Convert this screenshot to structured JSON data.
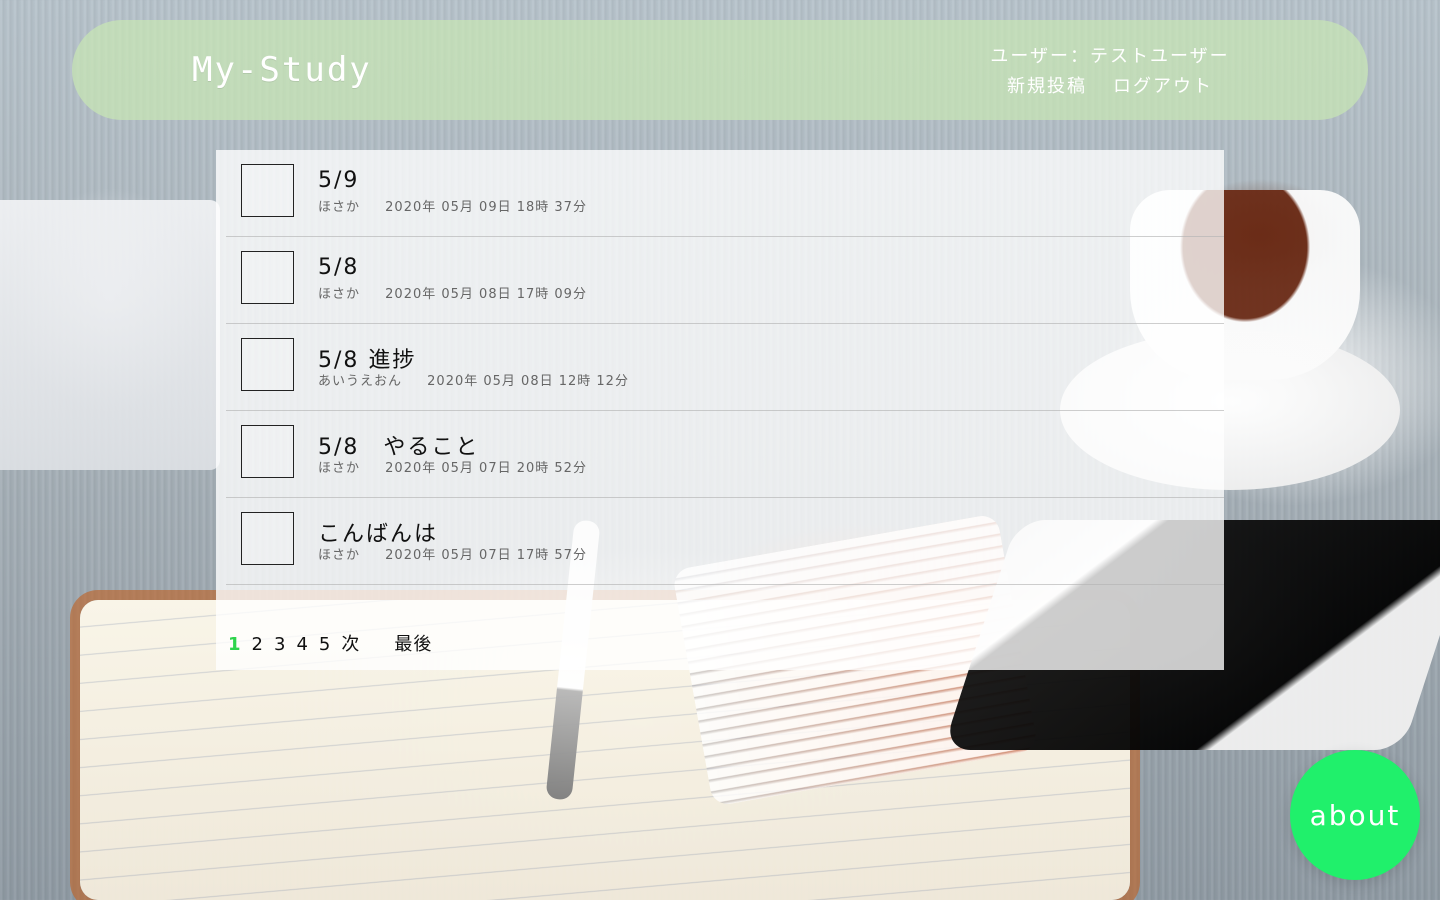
{
  "header": {
    "logo": "My-Study",
    "user_label": "ユーザー：テストユーザー",
    "new_post": "新規投稿",
    "logout": "ログアウト"
  },
  "posts": [
    {
      "title": "5/9",
      "author": "ほさか",
      "datetime": "2020年 05月 09日 18時 37分"
    },
    {
      "title": "5/8",
      "author": "ほさか",
      "datetime": "2020年 05月 08日 17時 09分"
    },
    {
      "title": "5/8 進捗",
      "author": "あいうえおん",
      "datetime": "2020年 05月 08日 12時 12分"
    },
    {
      "title": "5/8　やること",
      "author": "ほさか",
      "datetime": "2020年 05月 07日 20時 52分"
    },
    {
      "title": "こんばんは",
      "author": "ほさか",
      "datetime": "2020年 05月 07日 17時 57分"
    }
  ],
  "pagination": {
    "current": "1",
    "pages": [
      "2",
      "3",
      "4",
      "5"
    ],
    "next": "次",
    "last": "最後"
  },
  "about_button": "about",
  "colors": {
    "header_bg": "#c8e6b4",
    "accent_green": "#2ed44c",
    "about_green": "#20f06b"
  }
}
